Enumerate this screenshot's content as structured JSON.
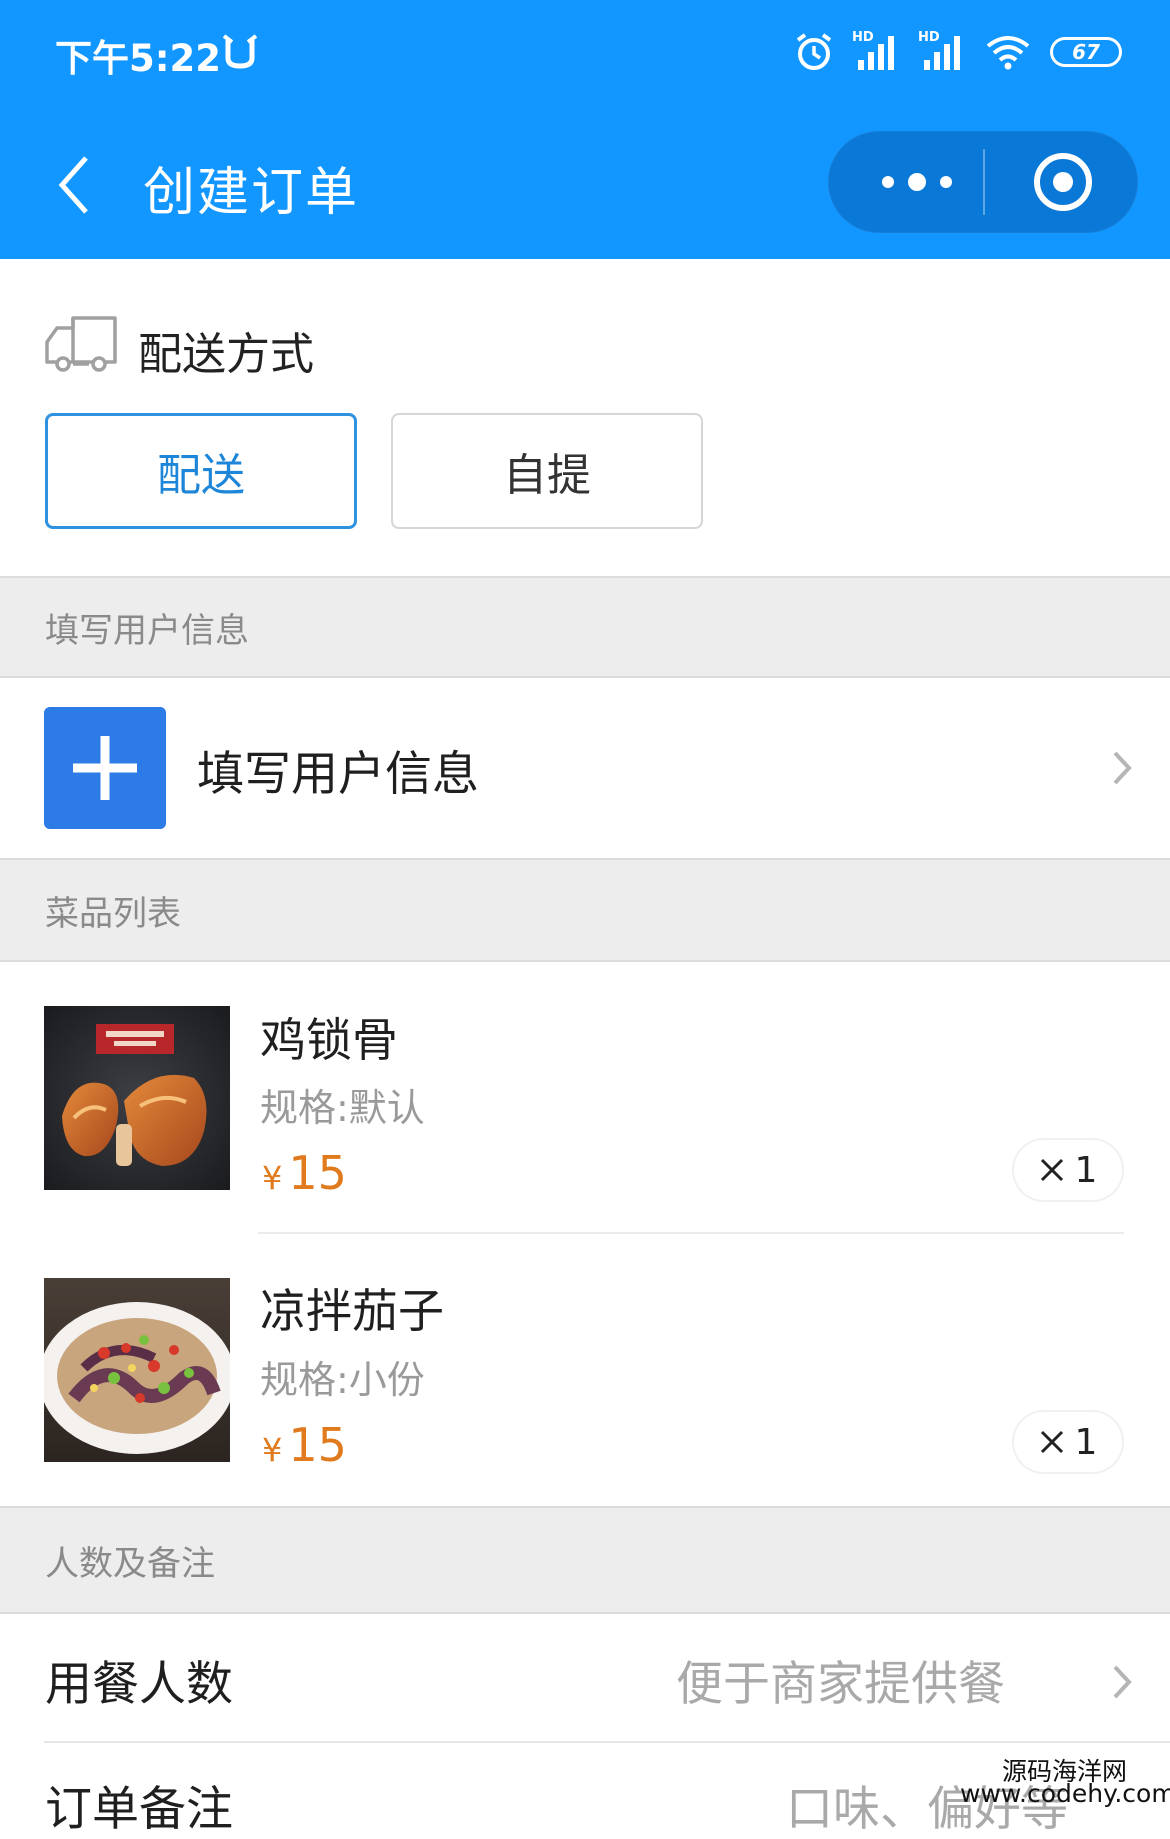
{
  "status_bar": {
    "time": "下午5:22",
    "signal_label_1": "HD",
    "signal_label_2": "HD",
    "battery": "67"
  },
  "nav": {
    "title": "创建订单"
  },
  "delivery": {
    "title": "配送方式",
    "options": [
      "配送",
      "自提"
    ],
    "selected": "配送"
  },
  "user_section": {
    "header": "填写用户信息",
    "row_label": "填写用户信息"
  },
  "dishes_section": {
    "header": "菜品列表",
    "items": [
      {
        "name": "鸡锁骨",
        "spec": "规格:默认",
        "currency": "¥",
        "price": "15",
        "qty": "1"
      },
      {
        "name": "凉拌茄子",
        "spec": "规格:小份",
        "currency": "¥",
        "price": "15",
        "qty": "1"
      }
    ]
  },
  "people_section": {
    "header": "人数及备注",
    "diners_label": "用餐人数",
    "diners_placeholder": "便于商家提供餐",
    "note_label": "订单备注",
    "note_placeholder": "口味、偏好等"
  },
  "watermark": {
    "line1": "源码海洋网",
    "line2": "www.codehy.com"
  },
  "colors": {
    "header_blue": "#1296ff",
    "accent_blue": "#2f92df",
    "price_orange": "#e07a1c",
    "plus_blue": "#2d7be6"
  }
}
